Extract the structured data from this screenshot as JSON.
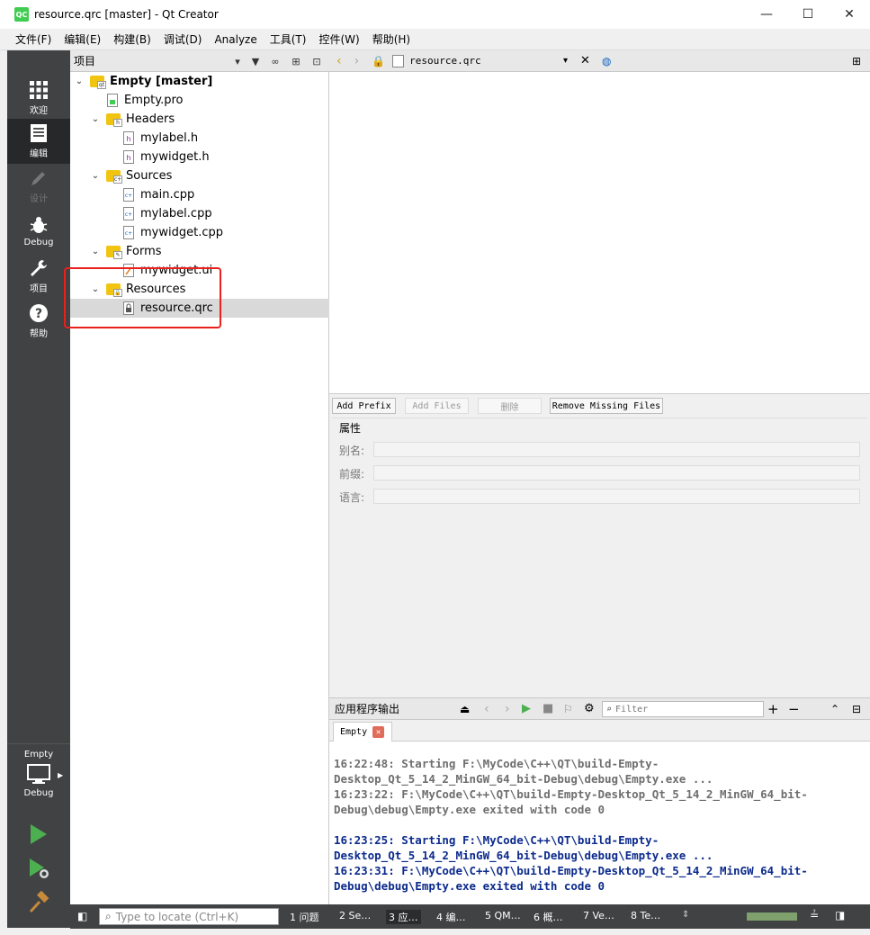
{
  "window": {
    "title": "resource.qrc [master] - Qt Creator",
    "app_icon": "QC",
    "minimize": "—",
    "maximize": "☐",
    "close": "✕"
  },
  "menu": [
    "文件(F)",
    "编辑(E)",
    "构建(B)",
    "调试(D)",
    "Analyze",
    "工具(T)",
    "控件(W)",
    "帮助(H)"
  ],
  "modes": [
    {
      "label": "欢迎",
      "icon": "grid-icon",
      "state": "normal"
    },
    {
      "label": "编辑",
      "icon": "document-icon",
      "state": "active"
    },
    {
      "label": "设计",
      "icon": "pencil-icon",
      "state": "disabled"
    },
    {
      "label": "Debug",
      "icon": "bug-icon",
      "state": "normal"
    },
    {
      "label": "项目",
      "icon": "wrench-icon",
      "state": "normal"
    },
    {
      "label": "帮助",
      "icon": "help-icon",
      "state": "normal"
    }
  ],
  "kit": {
    "project": "Empty",
    "build": "Debug"
  },
  "project_panel": {
    "title": "项目",
    "tree": [
      {
        "label": "Empty [master]",
        "level": 0,
        "kind": "project",
        "bold": true
      },
      {
        "label": "Empty.pro",
        "level": 1,
        "kind": "pro"
      },
      {
        "label": "Headers",
        "level": 1,
        "kind": "folder-h"
      },
      {
        "label": "mylabel.h",
        "level": 2,
        "kind": "h"
      },
      {
        "label": "mywidget.h",
        "level": 2,
        "kind": "h"
      },
      {
        "label": "Sources",
        "level": 1,
        "kind": "folder-cpp"
      },
      {
        "label": "main.cpp",
        "level": 2,
        "kind": "cpp"
      },
      {
        "label": "mylabel.cpp",
        "level": 2,
        "kind": "cpp"
      },
      {
        "label": "mywidget.cpp",
        "level": 2,
        "kind": "cpp"
      },
      {
        "label": "Forms",
        "level": 1,
        "kind": "folder-ui"
      },
      {
        "label": "mywidget.ui",
        "level": 2,
        "kind": "ui"
      },
      {
        "label": "Resources",
        "level": 1,
        "kind": "folder-res"
      },
      {
        "label": "resource.qrc",
        "level": 2,
        "kind": "qrc",
        "selected": true
      }
    ]
  },
  "editor": {
    "document": "resource.qrc"
  },
  "resource_editor": {
    "add_prefix": "Add Prefix",
    "add_files": "Add Files",
    "delete": "删除",
    "remove_missing": "Remove Missing Files",
    "properties_title": "属性",
    "alias_label": "别名:",
    "prefix_label": "前缀:",
    "language_label": "语言:"
  },
  "output": {
    "title": "应用程序输出",
    "filter_placeholder": "Filter",
    "tab": "Empty",
    "lines": [
      {
        "text": "16:22:48: Starting F:\\MyCode\\C++\\QT\\build-Empty-",
        "style": "gray"
      },
      {
        "text": "Desktop_Qt_5_14_2_MinGW_64_bit-Debug\\debug\\Empty.exe ...",
        "style": "gray"
      },
      {
        "text": "16:23:22: F:\\MyCode\\C++\\QT\\build-Empty-Desktop_Qt_5_14_2_MinGW_64_bit-",
        "style": "gray"
      },
      {
        "text": "Debug\\debug\\Empty.exe exited with code 0",
        "style": "gray"
      },
      {
        "text": "",
        "style": "gap"
      },
      {
        "text": "16:23:25: Starting F:\\MyCode\\C++\\QT\\build-Empty-",
        "style": "blue"
      },
      {
        "text": "Desktop_Qt_5_14_2_MinGW_64_bit-Debug\\debug\\Empty.exe ...",
        "style": "blue"
      },
      {
        "text": "16:23:31: F:\\MyCode\\C++\\QT\\build-Empty-Desktop_Qt_5_14_2_MinGW_64_bit-",
        "style": "blue"
      },
      {
        "text": "Debug\\debug\\Empty.exe exited with code 0",
        "style": "blue"
      }
    ]
  },
  "statusbar": {
    "locator_placeholder": "Type to locate (Ctrl+K)",
    "tabs": [
      "1 问题",
      "2 Se…",
      "3 应…",
      "4 编…",
      "5 QM…",
      "6 概…",
      "7 Ve…",
      "8 Te…"
    ],
    "active_tab": 2,
    "progress": 1.0
  },
  "colors": {
    "sidebar": "#404244",
    "highlight": "#e8211d",
    "output_blue": "#0b2a8c",
    "output_gray": "#6e6e6e",
    "run_green": "#4caf50"
  }
}
